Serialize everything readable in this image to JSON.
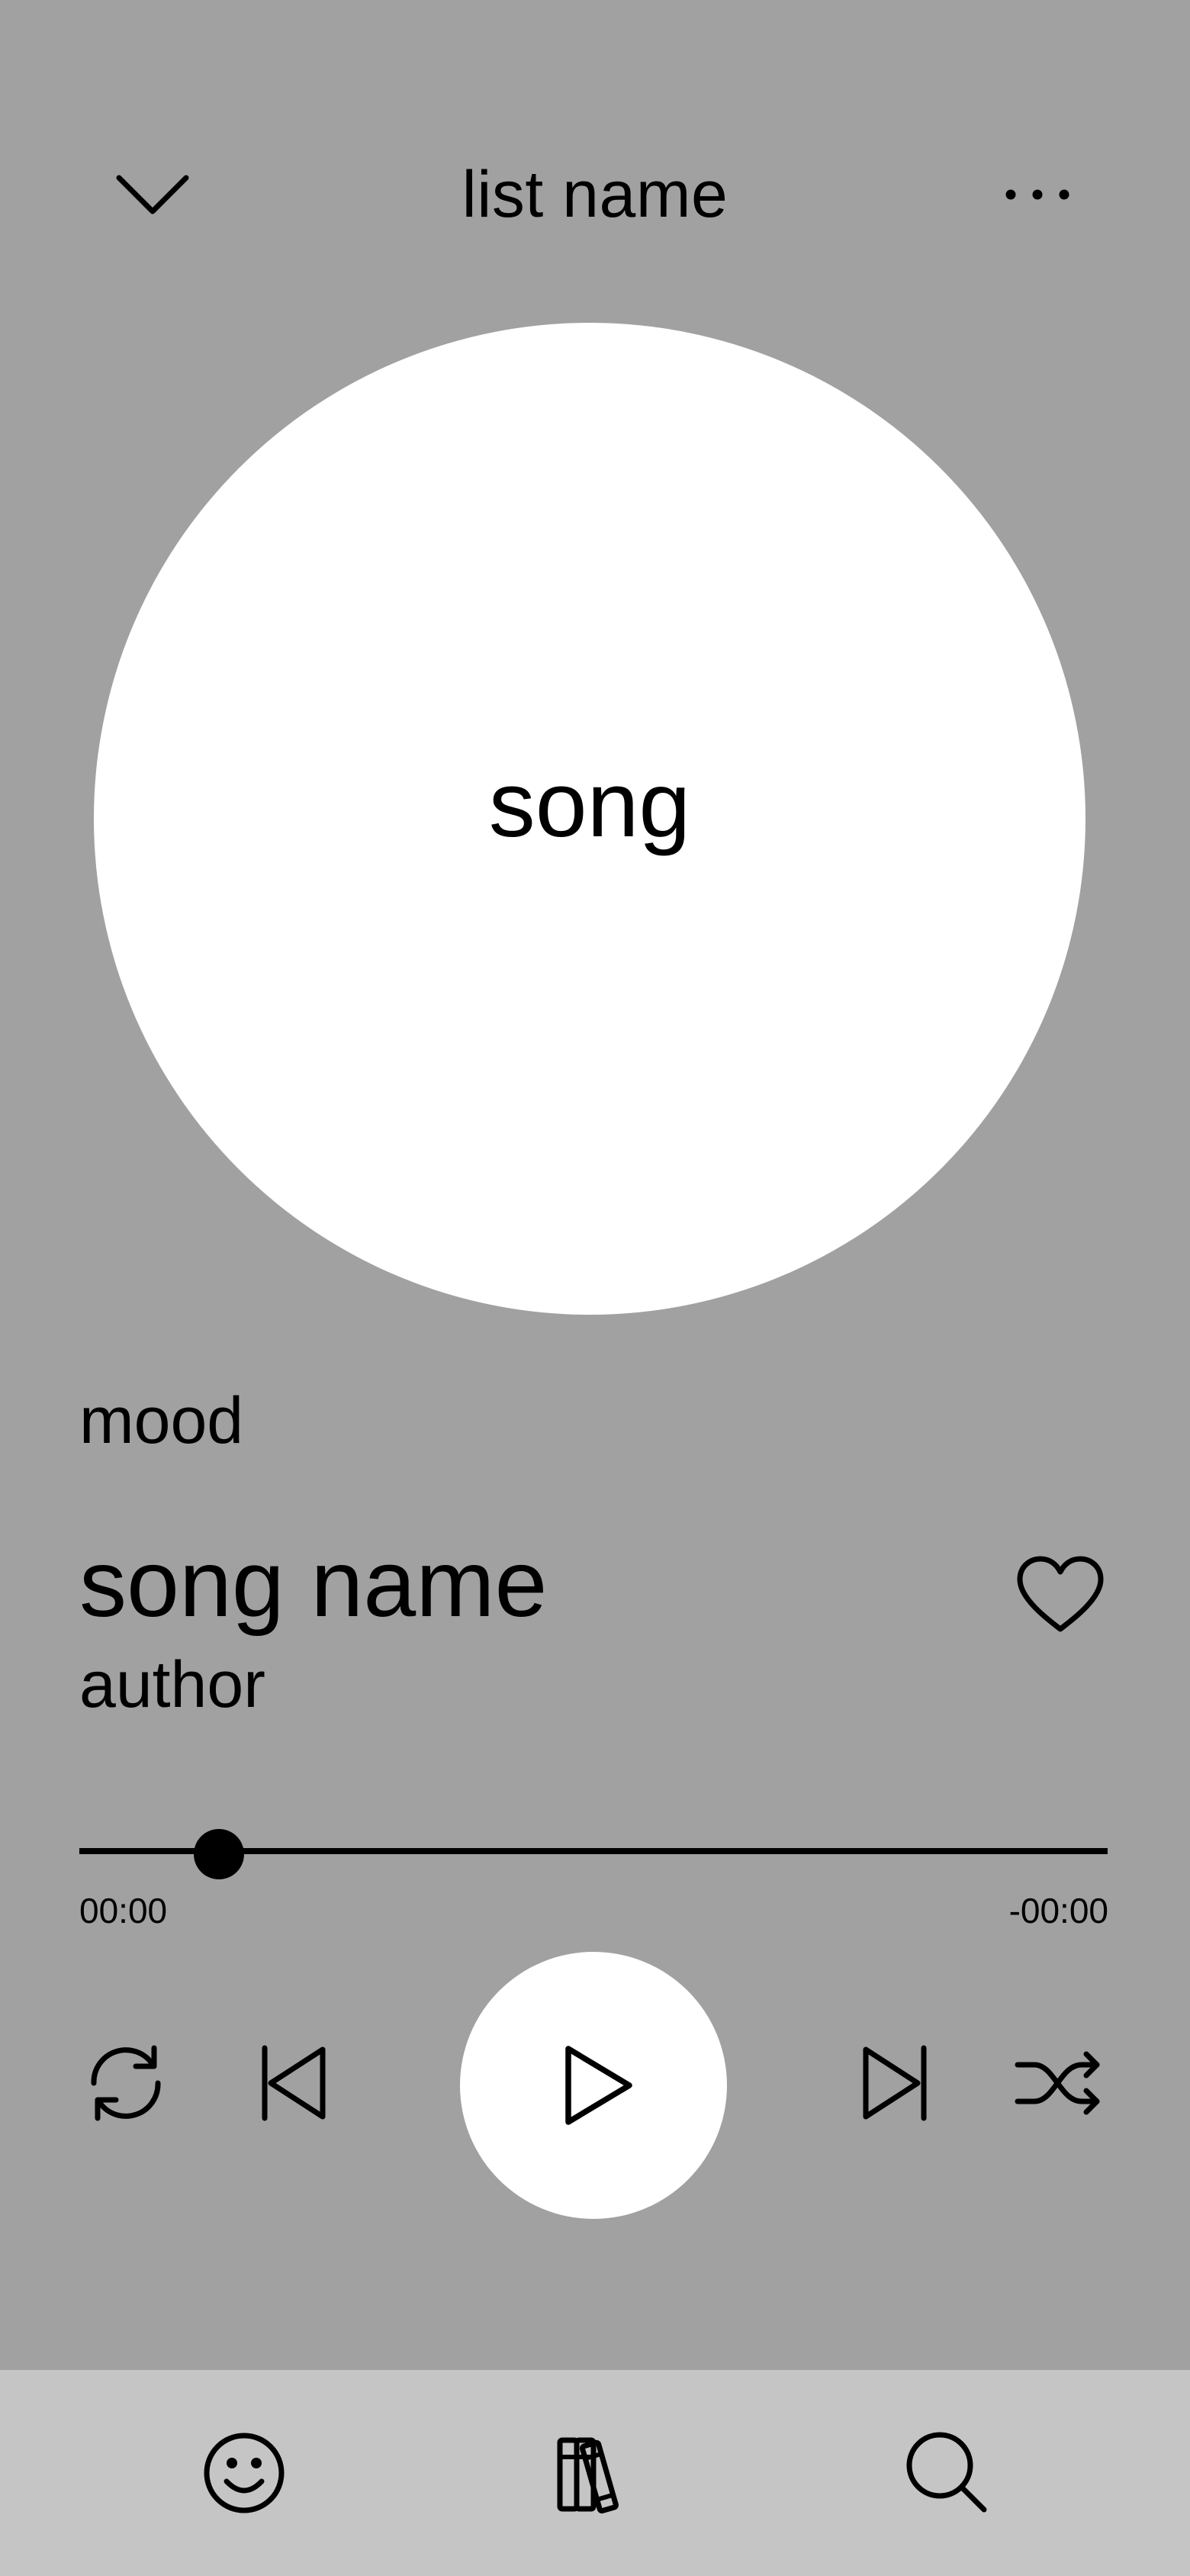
{
  "header": {
    "title": "list name",
    "collapse_icon": "chevron-down-icon",
    "menu_icon": "more-horizontal-icon"
  },
  "artwork": {
    "label": "song"
  },
  "track": {
    "mood": "mood",
    "song_name": "song name",
    "author": "author",
    "favorite_icon": "heart-icon"
  },
  "progress": {
    "fraction": 0.136,
    "elapsed": "00:00",
    "remaining": "-00:00"
  },
  "controls": {
    "repeat_icon": "repeat-icon",
    "previous_icon": "skip-back-icon",
    "play_icon": "play-icon",
    "next_icon": "skip-forward-icon",
    "shuffle_icon": "shuffle-icon"
  },
  "bottom_nav": {
    "items": [
      {
        "icon": "smiley-icon"
      },
      {
        "icon": "library-icon"
      },
      {
        "icon": "search-icon"
      }
    ]
  },
  "colors": {
    "background": "#a1a1a1",
    "surface": "#ffffff",
    "nav_background": "#c5c5c5",
    "foreground": "#000000"
  }
}
